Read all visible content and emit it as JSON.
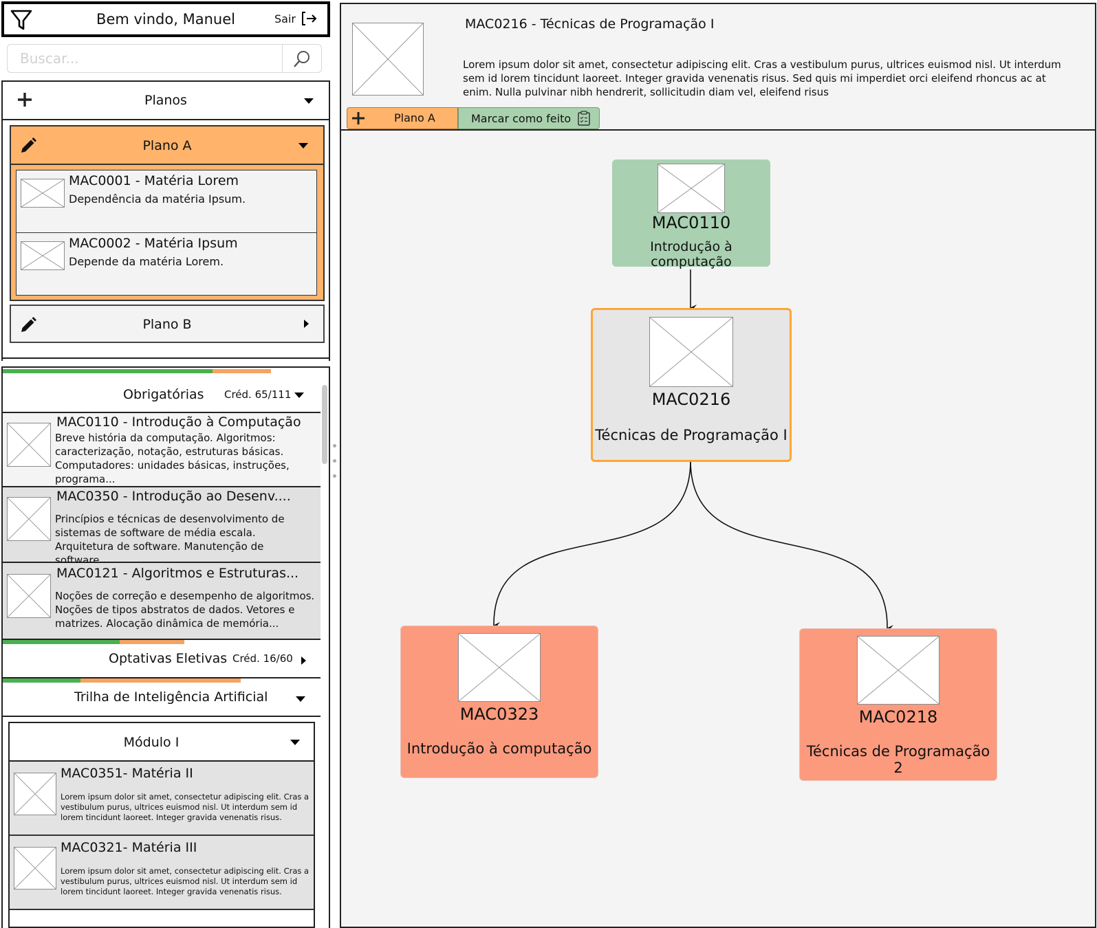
{
  "header": {
    "welcome": "Bem vindo, Manuel",
    "logout_label": "Sair"
  },
  "search": {
    "placeholder": "Buscar..."
  },
  "plans": {
    "header_label": "Planos",
    "plan_a": {
      "label": "Plano A",
      "courses": [
        {
          "title": "MAC0001 - Matéria Lorem",
          "desc": "Dependência da matéria Ipsum."
        },
        {
          "title": "MAC0002 - Matéria Ipsum",
          "desc": "Depende da matéria Lorem."
        }
      ]
    },
    "plan_b": {
      "label": "Plano B"
    }
  },
  "sections": {
    "obrigatorias": {
      "label": "Obrigatórias",
      "credits": "Créd. 65/111",
      "progress": {
        "done": 0.64,
        "planned": 0.19
      },
      "courses": [
        {
          "title": "MAC0110 - Introdução à Computação",
          "desc": "Breve história da computação. Algoritmos: caracterização, notação, estruturas básicas. Computadores: unidades básicas, instruções, programa..."
        },
        {
          "title": "MAC0350 - Introdução ao Desenv....",
          "desc": "Princípios e técnicas de desenvolvimento de sistemas de software de média escala. Arquitetura de software. Manutenção de software...."
        },
        {
          "title": "MAC0121 - Algoritmos e Estruturas...",
          "desc": "Noções de correção e desempenho de algoritmos. Noções de tipos abstratos de dados. Vetores e matrizes. Alocação dinâmica de memória..."
        }
      ]
    },
    "optativas": {
      "label": "Optativas Eletivas",
      "credits": "Créd. 16/60",
      "progress": {
        "done": 0.37,
        "planned": 0.2
      }
    },
    "trilha": {
      "label": "Trilha de Inteligência Artificial",
      "progress": {
        "done": 0.25,
        "planned": 0.5
      },
      "modulo": {
        "label": "Módulo I",
        "courses": [
          {
            "title": "MAC0351- Matéria II",
            "desc": "Lorem ipsum dolor sit amet, consectetur adipiscing elit. Cras a vestibulum purus, ultrices euismod nisl. Ut interdum sem id lorem tincidunt laoreet. Integer gravida venenatis risus."
          },
          {
            "title": "MAC0321- Matéria III",
            "desc": "Lorem ipsum dolor sit amet, consectetur adipiscing elit. Cras a vestibulum purus, ultrices euismod nisl. Ut interdum sem id lorem tincidunt laoreet. Integer gravida venenatis risus."
          }
        ]
      }
    }
  },
  "detail": {
    "title": "MAC0216 - Técnicas de Programação I",
    "description": "Lorem ipsum dolor sit amet, consectetur adipiscing elit. Cras a vestibulum purus, ultrices euismod nisl. Ut interdum sem id lorem tincidunt laoreet. Integer gravida venenatis risus. Sed quis mi imperdiet orci eleifend rhoncus ac at enim. Nulla pulvinar nibh hendrerit, sollicitudin diam vel, eleifend risus",
    "plan_button": "Plano A",
    "done_button": "Marcar como feito"
  },
  "graph": {
    "nodes": {
      "prereq": {
        "code": "MAC0110",
        "name": "Introdução à computação",
        "status": "done",
        "color": "#a9d1b1"
      },
      "current": {
        "code": "MAC0216",
        "name": "Técnicas de Programação I",
        "status": "current",
        "color": "#ffa534"
      },
      "next_left": {
        "code": "MAC0323",
        "name": "Introdução à computação",
        "status": "pending",
        "color": "#fc9a7e"
      },
      "next_right": {
        "code": "MAC0218",
        "name": "Técnicas de Programação 2",
        "status": "pending",
        "color": "#fc9a7e"
      }
    }
  },
  "colors": {
    "plan_accent": "#ffb36b",
    "done_green": "#a9d1b1",
    "progress_done": "#4caf50",
    "progress_planned": "#f4a460"
  }
}
